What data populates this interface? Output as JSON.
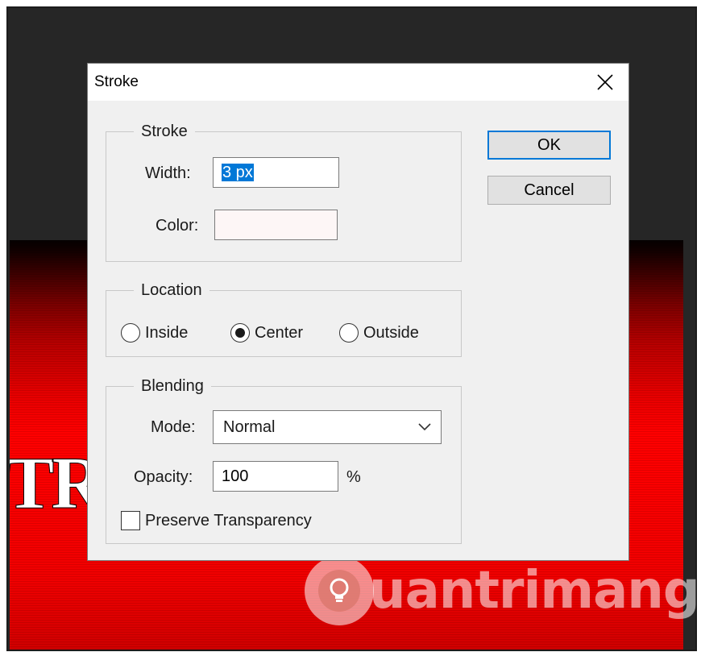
{
  "background": {
    "canvas_text": "TR",
    "watermark_text": "uantrimang",
    "colors": {
      "canvas_red": "#ff0000",
      "workspace": "#262626"
    }
  },
  "dialog": {
    "title": "Stroke",
    "close_icon": "close-icon",
    "stroke_group": {
      "legend": "Stroke",
      "width_label": "Width:",
      "width_value": "3 px",
      "color_label": "Color:",
      "color_value": "#fdf6f6"
    },
    "location_group": {
      "legend": "Location",
      "options": [
        "Inside",
        "Center",
        "Outside"
      ],
      "selected": "Center"
    },
    "blending_group": {
      "legend": "Blending",
      "mode_label": "Mode:",
      "mode_value": "Normal",
      "opacity_label": "Opacity:",
      "opacity_value": "100",
      "opacity_unit": "%",
      "preserve_label": "Preserve Transparency",
      "preserve_checked": false
    },
    "buttons": {
      "ok": "OK",
      "cancel": "Cancel"
    },
    "accent_color": "#0078d7"
  }
}
